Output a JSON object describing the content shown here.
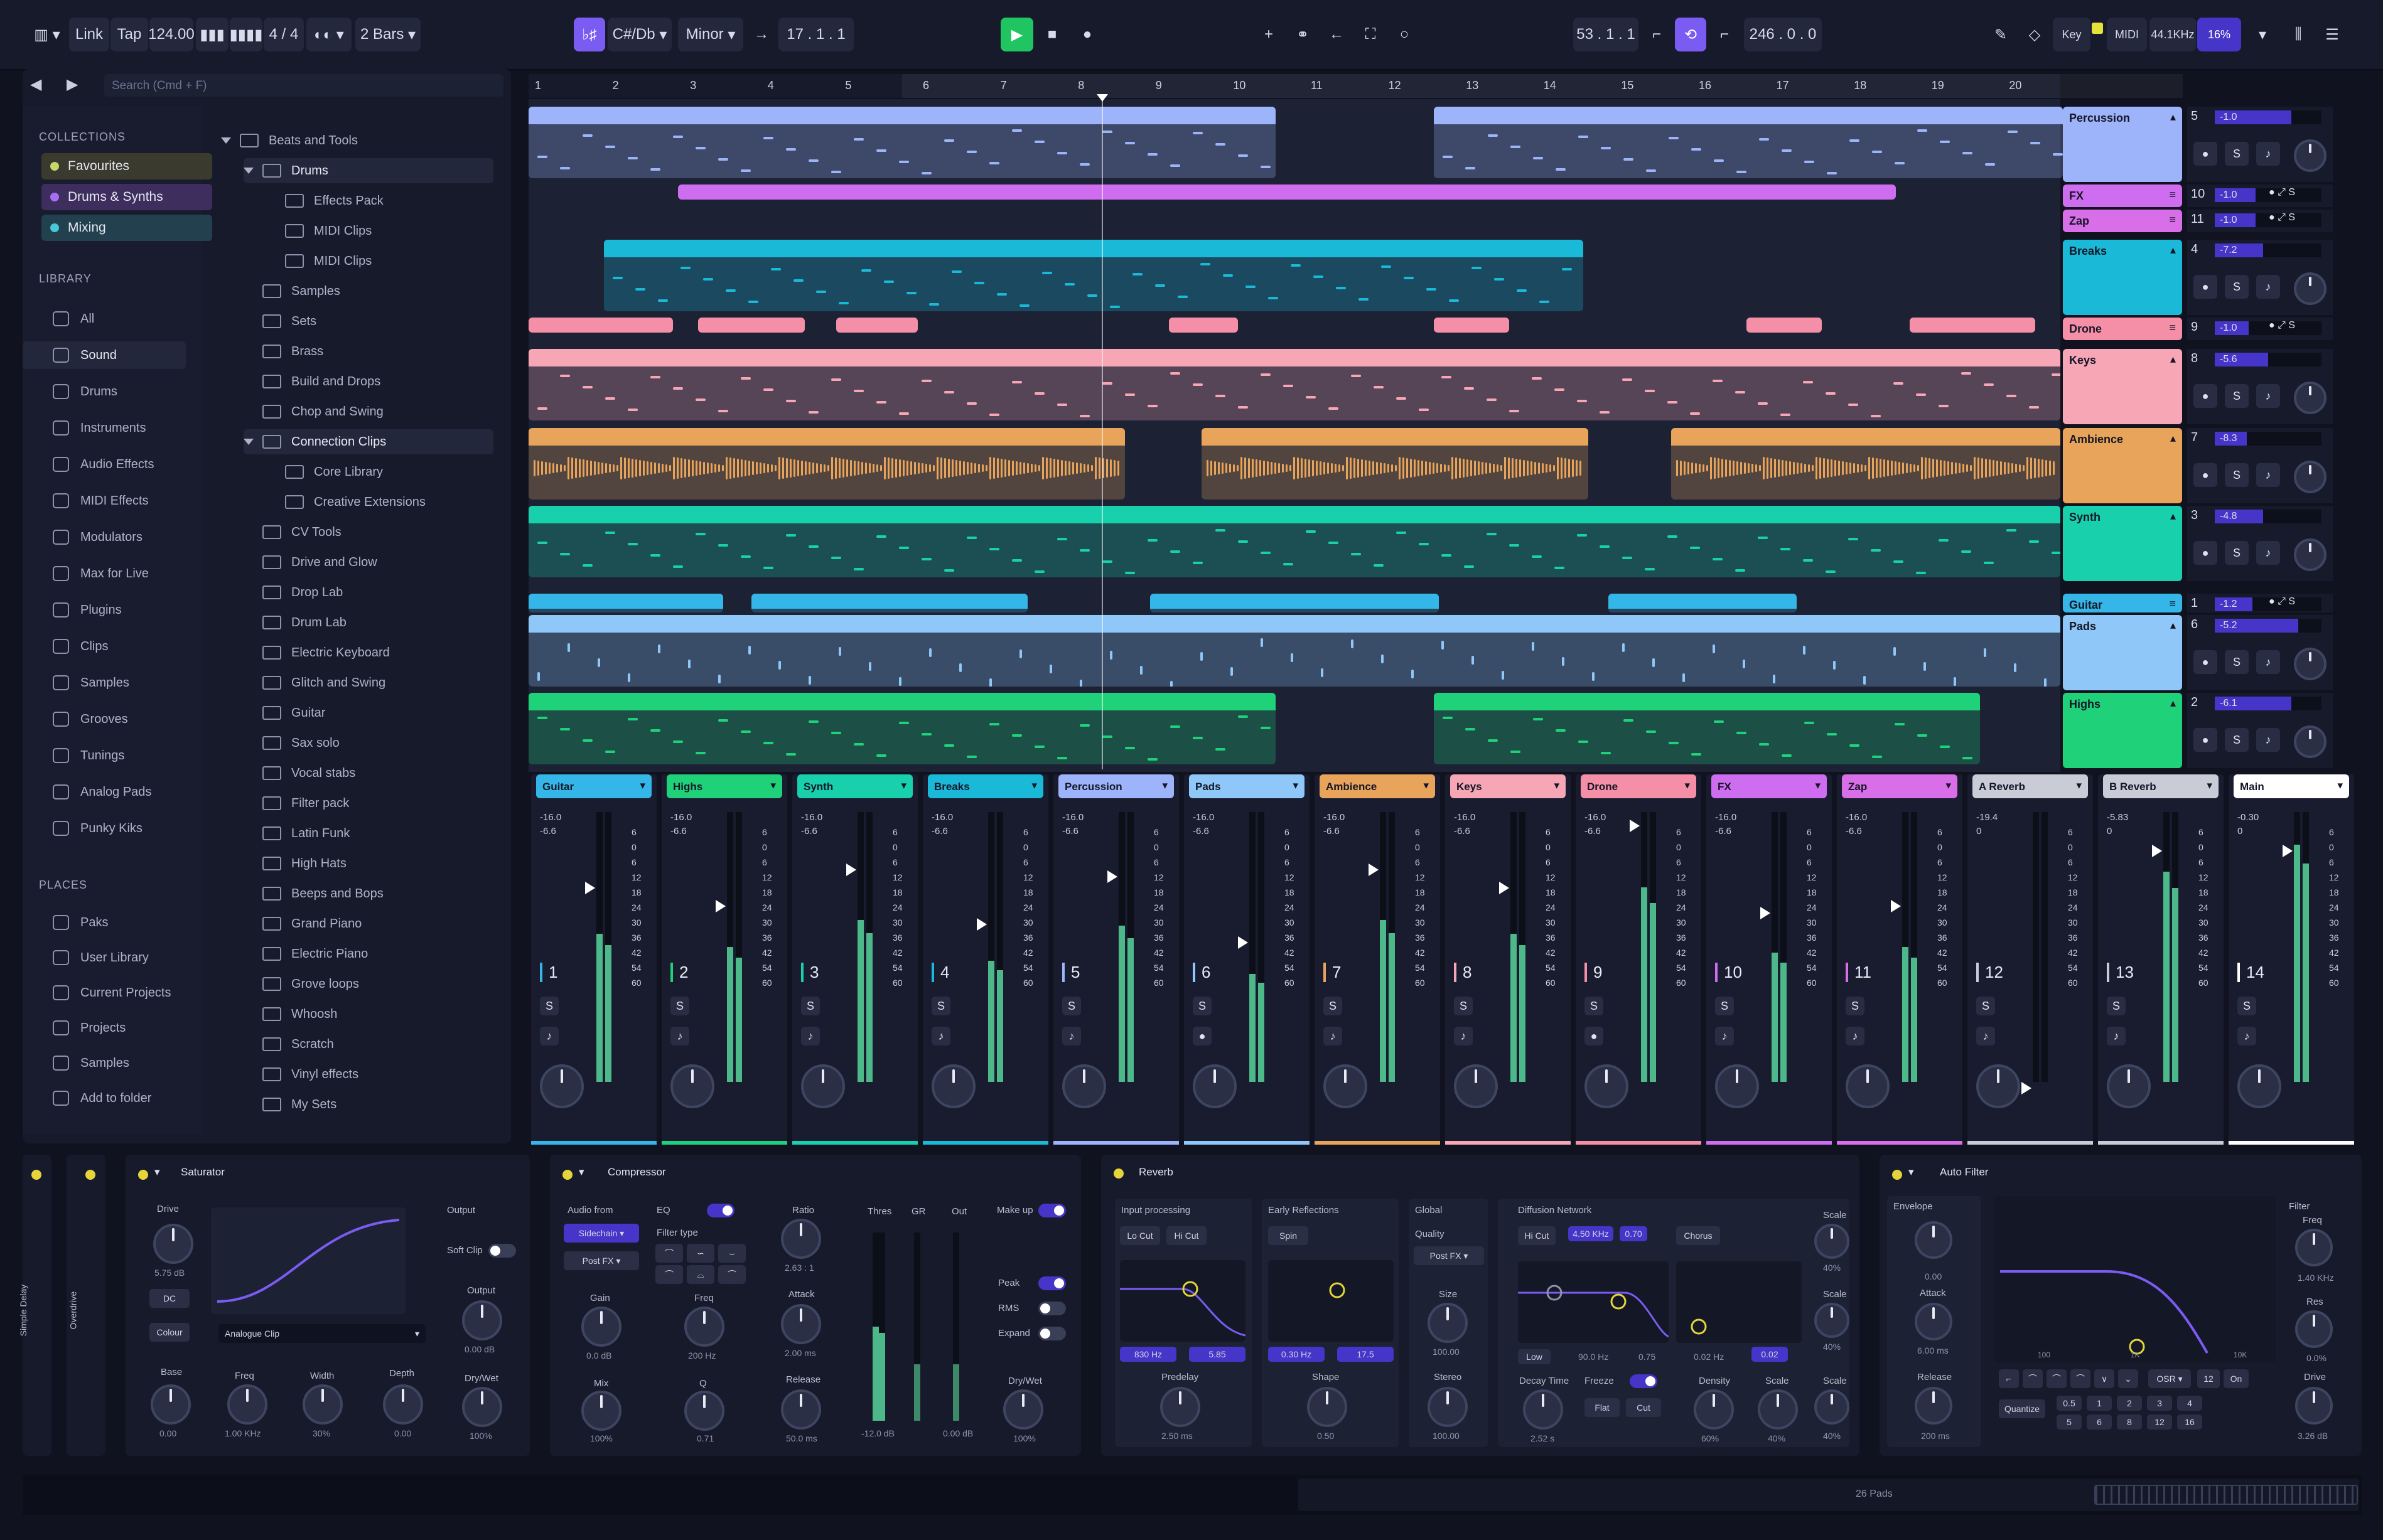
{
  "toolbar": {
    "link": "Link",
    "tap": "Tap",
    "tempo": "124.00",
    "time_sig": "4 / 4",
    "bars": "2 Bars",
    "key": "C#/Db",
    "scale": "Minor",
    "position": "17 . 1 . 1",
    "loop_pos": "53 . 1 . 1",
    "loop_len": "246 . 0 . 0",
    "key_btn": "Key",
    "midi_btn": "MIDI",
    "sample_rate": "44.1KHz",
    "cpu": "16%"
  },
  "browser": {
    "search_placeholder": "Search (Cmd + F)",
    "collections_label": "COLLECTIONS",
    "collections": [
      {
        "label": "Favourites",
        "color": "#c8d66a"
      },
      {
        "label": "Drums & Synths",
        "color": "#a66ef2"
      },
      {
        "label": "Mixing",
        "color": "#46c8d8"
      }
    ],
    "library_label": "LIBRARY",
    "library": [
      "All",
      "Sound",
      "Drums",
      "Instruments",
      "Audio Effects",
      "MIDI Effects",
      "Modulators",
      "Max for Live",
      "Plugins",
      "Clips",
      "Samples",
      "Grooves",
      "Tunings",
      "Analog Pads",
      "Punky Kiks"
    ],
    "places_label": "PLACES",
    "places": [
      "Paks",
      "User Library",
      "Current Projects",
      "Projects",
      "Samples",
      "Add to folder"
    ],
    "tree": [
      "Beats and Tools",
      "Drums",
      "Effects Pack",
      "MIDI Clips",
      "MIDI Clips",
      "Samples",
      "Sets",
      "Brass",
      "Build and Drops",
      "Chop and Swing",
      "Connection Clips",
      "Core Library",
      "Creative Extensions",
      "CV Tools",
      "Drive and Glow",
      "Drop Lab",
      "Drum Lab",
      "Electric Keyboard",
      "Glitch and Swing",
      "Guitar",
      "Sax solo",
      "Vocal stabs",
      "Filter pack",
      "Latin Funk",
      "High Hats",
      "Beeps and Bops",
      "Grand Piano",
      "Electric Piano",
      "Grove loops",
      "Whoosh",
      "Scratch",
      "Vinyl effects",
      "My Sets"
    ]
  },
  "ruler": [
    "1",
    "2",
    "3",
    "4",
    "5",
    "6",
    "7",
    "8",
    "9",
    "10",
    "11",
    "12",
    "13",
    "14",
    "15",
    "16",
    "17",
    "18",
    "19",
    "20"
  ],
  "tracks": [
    {
      "name": "Percussion",
      "num": "5",
      "vol": "-1.0",
      "level": 0.72,
      "color": "#9db4fb"
    },
    {
      "name": "FX",
      "num": "10",
      "vol": "-1.0",
      "level": 0.38,
      "color": "#cf6df0"
    },
    {
      "name": "Zap",
      "num": "11",
      "vol": "-1.0",
      "level": 0.38,
      "color": "#d86ee8"
    },
    {
      "name": "Breaks",
      "num": "4",
      "vol": "-7.2",
      "level": 0.45,
      "color": "#1ab9d8"
    },
    {
      "name": "Drone",
      "num": "9",
      "vol": "-1.0",
      "level": 0.32,
      "color": "#f58fa8"
    },
    {
      "name": "Keys",
      "num": "8",
      "vol": "-5.6",
      "level": 0.5,
      "color": "#f7a6b6"
    },
    {
      "name": "Ambience",
      "num": "7",
      "vol": "-8.3",
      "level": 0.3,
      "color": "#e8a45a"
    },
    {
      "name": "Synth",
      "num": "3",
      "vol": "-4.8",
      "level": 0.45,
      "color": "#19d0ad"
    },
    {
      "name": "Guitar",
      "num": "1",
      "vol": "-1.2",
      "level": 0.35,
      "color": "#35b6e8"
    },
    {
      "name": "Pads",
      "num": "6",
      "vol": "-5.2",
      "level": 0.78,
      "color": "#8fc7f8"
    },
    {
      "name": "Highs",
      "num": "2",
      "vol": "-6.1",
      "level": 0.72,
      "color": "#1fd27a"
    }
  ],
  "mixer": [
    {
      "name": "Guitar",
      "num": "1",
      "peak": "-16.0",
      "rms": "-6.6",
      "color": "#35b6e8"
    },
    {
      "name": "Highs",
      "num": "2",
      "peak": "-16.0",
      "rms": "-6.6",
      "color": "#1fd27a"
    },
    {
      "name": "Synth",
      "num": "3",
      "peak": "-16.0",
      "rms": "-6.6",
      "color": "#19d0ad"
    },
    {
      "name": "Breaks",
      "num": "4",
      "peak": "-16.0",
      "rms": "-6.6",
      "color": "#1ab9d8"
    },
    {
      "name": "Percussion",
      "num": "5",
      "peak": "-16.0",
      "rms": "-6.6",
      "color": "#9db4fb"
    },
    {
      "name": "Pads",
      "num": "6",
      "peak": "-16.0",
      "rms": "-6.6",
      "color": "#8fc7f8"
    },
    {
      "name": "Ambience",
      "num": "7",
      "peak": "-16.0",
      "rms": "-6.6",
      "color": "#e8a45a"
    },
    {
      "name": "Keys",
      "num": "8",
      "peak": "-16.0",
      "rms": "-6.6",
      "color": "#f7a6b6"
    },
    {
      "name": "Drone",
      "num": "9",
      "peak": "-16.0",
      "rms": "-6.6",
      "color": "#f58fa8"
    },
    {
      "name": "FX",
      "num": "10",
      "peak": "-16.0",
      "rms": "-6.6",
      "color": "#cf6df0"
    },
    {
      "name": "Zap",
      "num": "11",
      "peak": "-16.0",
      "rms": "-6.6",
      "color": "#d86ee8"
    },
    {
      "name": "A Reverb",
      "num": "12",
      "peak": "-19.4",
      "rms": "0",
      "color": "#c9cbd6"
    },
    {
      "name": "B Reverb",
      "num": "13",
      "peak": "-5.83",
      "rms": "0",
      "color": "#c9cbd6"
    },
    {
      "name": "Main",
      "num": "14",
      "peak": "-0.30",
      "rms": "0",
      "color": "#ffffff"
    }
  ],
  "scale": [
    "6",
    "0",
    "6",
    "12",
    "18",
    "24",
    "30",
    "36",
    "42",
    "54",
    "60"
  ],
  "devices": {
    "sidebar": [
      "Simple Delay",
      "Overdrive"
    ],
    "saturator": {
      "title": "Saturator",
      "drive": "Drive",
      "drive_val": "5.75 dB",
      "dc": "DC",
      "colour": "Colour",
      "curve": "Analogue Clip",
      "base": "Base",
      "base_val": "0.00",
      "freq": "Freq",
      "freq_val": "1.00 KHz",
      "width": "Width",
      "width_val": "30%",
      "depth": "Depth",
      "depth_val": "0.00",
      "output_h": "Output",
      "soft_clip": "Soft Clip",
      "output": "Output",
      "output_val": "0.00 dB",
      "drywet": "Dry/Wet",
      "drywet_val": "100%"
    },
    "compressor": {
      "title": "Compressor",
      "audio_from": "Audio from",
      "sidechain": "Sidechain",
      "postfx": "Post FX",
      "eq": "EQ",
      "filter_type": "Filter type",
      "gain": "Gain",
      "gain_val": "0.0 dB",
      "freq": "Freq",
      "freq_val": "200 Hz",
      "mix": "Mix",
      "mix_val": "100%",
      "q": "Q",
      "q_val": "0.71",
      "ratio": "Ratio",
      "ratio_val": "2.63 : 1",
      "attack": "Attack",
      "attack_val": "2.00 ms",
      "release": "Release",
      "release_val": "50.0 ms",
      "thres": "Thres",
      "gr": "GR",
      "out": "Out",
      "thres_val": "-12.0 dB",
      "out_val": "0.00 dB",
      "makeup": "Make up",
      "peak": "Peak",
      "rms": "RMS",
      "expand": "Expand",
      "drywet": "Dry/Wet",
      "drywet_val": "100%"
    },
    "reverb": {
      "title": "Reverb",
      "input": "Input processing",
      "locut": "Lo Cut",
      "hicut": "Hi Cut",
      "in_freq": "830 Hz",
      "in_q": "5.85",
      "predelay": "Predelay",
      "predelay_val": "2.50 ms",
      "early": "Early Reflections",
      "spin": "Spin",
      "er_freq": "0.30 Hz",
      "er_amt": "17.5",
      "shape": "Shape",
      "shape_val": "0.50",
      "global": "Global",
      "quality": "Quality",
      "quality_val": "Post FX",
      "size": "Size",
      "size_val": "100.00",
      "stereo": "Stereo",
      "stereo_val": "100.00",
      "diffusion": "Diffusion Network",
      "d_hicut": "Hi Cut",
      "d_freq": "4.50 KHz",
      "d_q": "0.70",
      "chorus": "Chorus",
      "low": "Low",
      "low_freq": "90.0 Hz",
      "low_q": "0.75",
      "ch_freq": "0.02 Hz",
      "ch_amt": "0.02",
      "decay": "Decay Time",
      "decay_val": "2.52 s",
      "freeze": "Freeze",
      "flat": "Flat",
      "cut": "Cut",
      "density": "Density",
      "density_val": "60%",
      "scale1": "Scale",
      "scale1_val": "40%",
      "scale2": "Scale",
      "scale2_val": "40%",
      "scale3": "Scale",
      "scale3_val": "40%",
      "scale4": "Scale",
      "scale4_val": "40%",
      "scale5": "Scale",
      "scale5_val": "40%"
    },
    "autofilter": {
      "title": "Auto Filter",
      "envelope": "Envelope",
      "env_val": "0.00",
      "attack": "Attack",
      "attack_val": "6.00 ms",
      "release": "Release",
      "release_val": "200 ms",
      "filter": "Filter",
      "freq": "Freq",
      "freq_val": "1.40 KHz",
      "res": "Res",
      "res_val": "0.0%",
      "drive": "Drive",
      "drive_val": "3.26 dB",
      "osr": "OSR",
      "n12": "12",
      "on": "On",
      "quantize": "Quantize",
      "grid": [
        "0.5",
        "1",
        "2",
        "3",
        "4",
        "5",
        "6",
        "8",
        "12",
        "16"
      ],
      "axis1": "100",
      "axis2": "1K",
      "axis3": "10K"
    }
  },
  "status": {
    "right": "26 Pads"
  }
}
